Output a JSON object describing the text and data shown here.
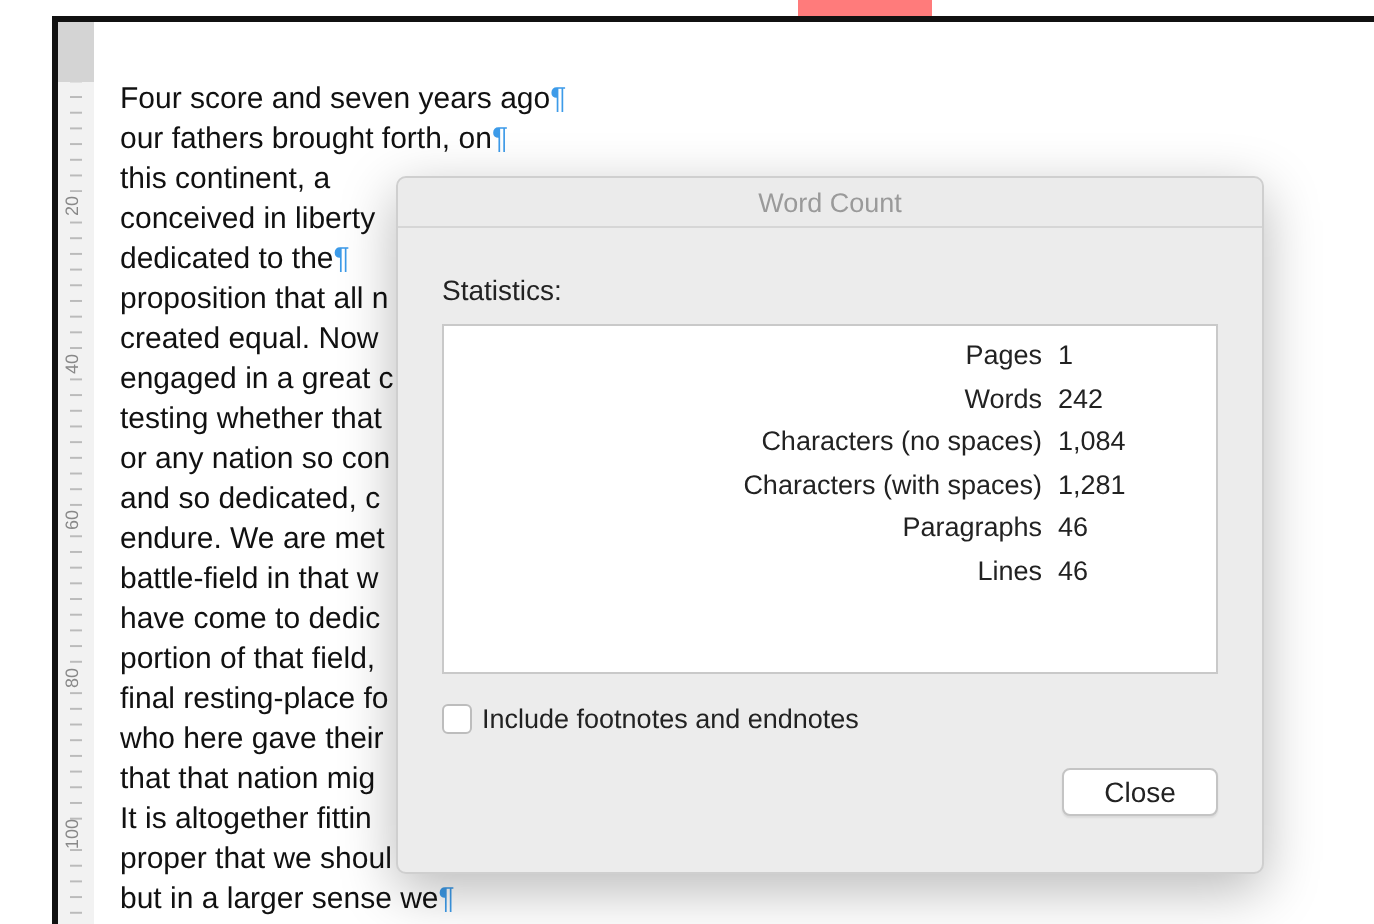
{
  "ruler": {
    "labels": [
      "20",
      "40",
      "60",
      "80",
      "100"
    ]
  },
  "document": {
    "lines": [
      {
        "text": "Four score and seven years ago",
        "mark": "¶"
      },
      {
        "text": "our fathers brought forth, on",
        "mark": "¶"
      },
      {
        "text": "this continent, a"
      },
      {
        "text": "conceived in liberty"
      },
      {
        "text": "dedicated to the",
        "mark": "¶"
      },
      {
        "text": "proposition that all n"
      },
      {
        "text": "created equal. Now"
      },
      {
        "text": "engaged in a great c"
      },
      {
        "text": "testing whether that"
      },
      {
        "text": "or any nation so con"
      },
      {
        "text": "and so dedicated, c"
      },
      {
        "text": "endure. We are met"
      },
      {
        "text": "battle-field in that w"
      },
      {
        "text": "have come to dedic"
      },
      {
        "text": "portion of that field,"
      },
      {
        "text": "final resting-place fo"
      },
      {
        "text": "who here gave their"
      },
      {
        "text": "that that nation mig"
      },
      {
        "text": "It is altogether fittin"
      },
      {
        "text": "proper that we shoul"
      },
      {
        "text": "but in a larger sense we",
        "mark": "¶"
      }
    ]
  },
  "dialog": {
    "title": "Word Count",
    "heading": "Statistics:",
    "statistics": [
      {
        "label": "Pages",
        "value": "1"
      },
      {
        "label": "Words",
        "value": "242"
      },
      {
        "label": "Characters (no spaces)",
        "value": "1,084"
      },
      {
        "label": "Characters (with spaces)",
        "value": "1,281"
      },
      {
        "label": "Paragraphs",
        "value": "46"
      },
      {
        "label": "Lines",
        "value": "46"
      }
    ],
    "option": {
      "label": "Include footnotes and endnotes",
      "checked": false
    },
    "button": "Close"
  }
}
